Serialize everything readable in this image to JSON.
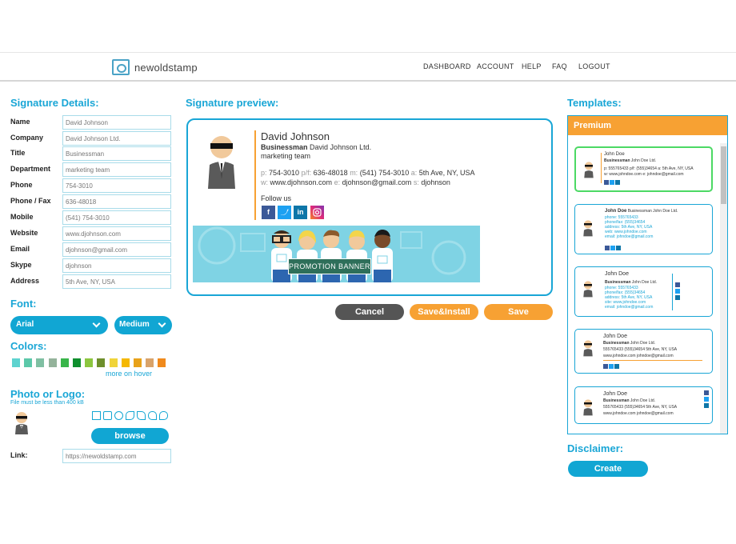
{
  "header": {
    "logo_text": "newoldstamp",
    "nav": [
      "DASHBOARD",
      "ACCOUNT",
      "HELP",
      "FAQ",
      "LOGOUT"
    ]
  },
  "details": {
    "title": "Signature Details:",
    "fields": [
      {
        "label": "Name",
        "value": "David Johnson"
      },
      {
        "label": "Company",
        "value": "David Johnson Ltd."
      },
      {
        "label": "Title",
        "value": "Businessman"
      },
      {
        "label": "Department",
        "value": "marketing team"
      },
      {
        "label": "Phone",
        "value": "754-3010"
      },
      {
        "label": "Phone / Fax",
        "value": "636-48018"
      },
      {
        "label": "Mobile",
        "value": "(541) 754-3010"
      },
      {
        "label": "Website",
        "value": "www.djohnson.com"
      },
      {
        "label": "Email",
        "value": "djohnson@gmail.com"
      },
      {
        "label": "Skype",
        "value": "djohnson"
      },
      {
        "label": "Address",
        "value": "5th Ave, NY, USA"
      }
    ]
  },
  "font": {
    "title": "Font:",
    "family": "Arial",
    "size": "Medium"
  },
  "colors": {
    "title": "Colors:",
    "swatches": [
      "#5ed3cf",
      "#5cc8a9",
      "#7fbfa2",
      "#94b39b",
      "#39b54a",
      "#0f8f2e",
      "#8cc63f",
      "#6e8f2c",
      "#f0d43a",
      "#f5b800",
      "#e8a21a",
      "#d9a36a",
      "#f08a1c"
    ],
    "more_label": "more on hover"
  },
  "photo": {
    "title": "Photo or Logo:",
    "note": "File must be less than 400 kB",
    "browse_label": "browse",
    "link_label": "Link:",
    "link_value": "https://newoldstamp.com"
  },
  "preview": {
    "title": "Signature preview:",
    "name": "David Johnson",
    "title_role": "Businessman",
    "company": "David Johnson Ltd.",
    "department": "marketing team",
    "phone_key": "p:",
    "phone": "754-3010",
    "fax_key": "p/f:",
    "fax": "636-48018",
    "mobile_key": "m:",
    "mobile": "(541) 754-3010",
    "address_key": "a:",
    "address": "5th Ave, NY, USA",
    "web_key": "w:",
    "web": "www.djohnson.com",
    "email_key": "e:",
    "email": "djohnson@gmail.com",
    "skype_key": "s:",
    "skype": "djohnson",
    "follow": "Follow us",
    "social": [
      "facebook",
      "twitter",
      "linkedin",
      "instagram"
    ],
    "banner_text": "PROMOTION BANNER"
  },
  "actions": {
    "cancel": "Cancel",
    "save_install": "Save&Install",
    "save": "Save"
  },
  "templates": {
    "title": "Templates:",
    "premium": "Premium",
    "cards": [
      {
        "name": "John Doe",
        "role": "Businessman",
        "company": "John Doe Ltd.",
        "line1": "p: 555765433  p/f: (555)34654  a: 5th Ave, NY, USA",
        "line2": "w: www.johndoe.com  e: johndoe@gmail.com"
      },
      {
        "name": "John Doe",
        "role": "Businessman",
        "company": "John Doe Ltd.",
        "line1": "phone: 555765433",
        "line2": "phone/fax: (555)34654",
        "line3": "address: 5th Ave, NY, USA",
        "line4": "web: www.johndoe.com",
        "line5": "email: johndoe@gmail.com"
      },
      {
        "name": "John Doe",
        "role": "Businessman",
        "company": "John Doe Ltd.",
        "line1": "phone: 555765433",
        "line2": "phone/fax: (555)34654",
        "line3": "address: 5th Ave, NY, USA",
        "line4": "site: www.johndoe.com",
        "line5": "email: johndoe@gmail.com"
      },
      {
        "name": "John Doe",
        "role": "Businessman",
        "company": "John Doe Ltd.",
        "line1": "555765433  (555)34654  5th Ave, NY, USA",
        "line2": "www.johndoe.com  johndoe@gmail.com"
      },
      {
        "name": "John Doe",
        "role": "Businessman",
        "company": "John Doe Ltd.",
        "line1": "555765433  (555)34654  5th Ave, NY, USA",
        "line2": "www.johndoe.com  johndoe@gmail.com"
      }
    ]
  },
  "disclaimer": {
    "title": "Disclaimer:",
    "create": "Create"
  }
}
